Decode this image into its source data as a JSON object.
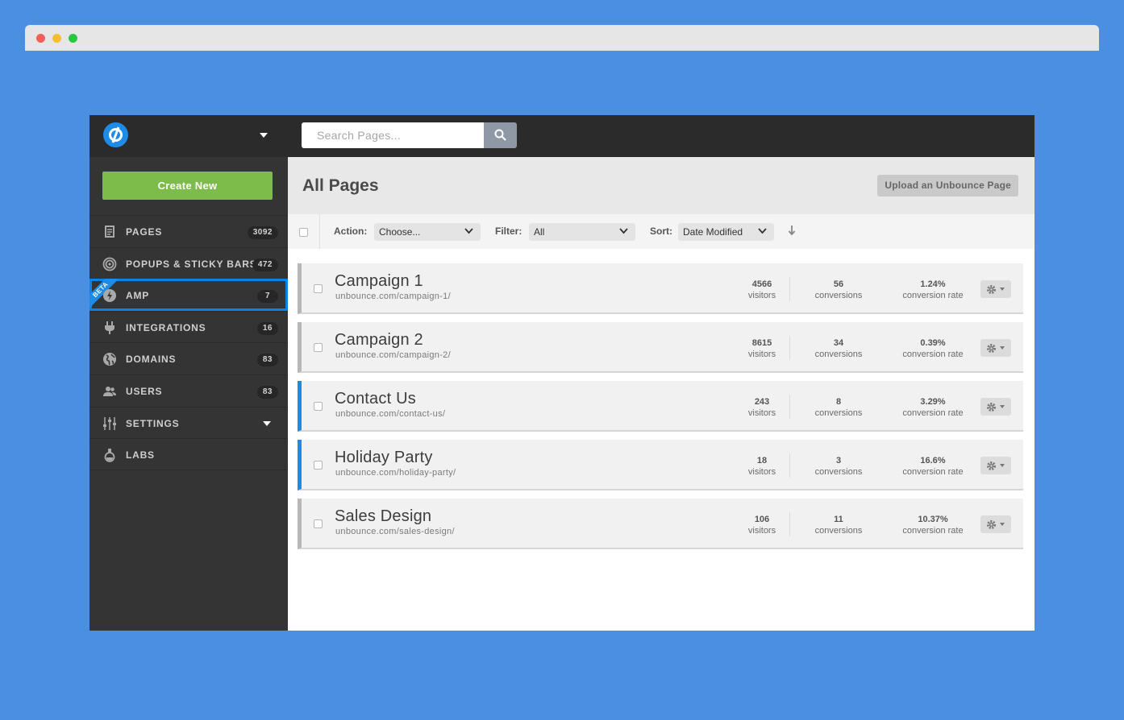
{
  "search": {
    "placeholder": "Search Pages..."
  },
  "sidebar": {
    "create_label": "Create New",
    "items": [
      {
        "label": "PAGES",
        "count": "3092",
        "icon": "pages-icon"
      },
      {
        "label": "POPUPS & STICKY BARS",
        "count": "472",
        "icon": "target-icon"
      },
      {
        "label": "AMP",
        "count": "7",
        "icon": "bolt-icon",
        "badge": "BETA"
      },
      {
        "label": "INTEGRATIONS",
        "count": "16",
        "icon": "plug-icon"
      },
      {
        "label": "DOMAINS",
        "count": "83",
        "icon": "globe-icon"
      },
      {
        "label": "USERS",
        "count": "83",
        "icon": "users-icon"
      },
      {
        "label": "SETTINGS",
        "count": "",
        "icon": "sliders-icon"
      },
      {
        "label": "LABS",
        "count": "",
        "icon": "flask-icon"
      }
    ]
  },
  "header": {
    "title": "All Pages",
    "upload_label": "Upload an Unbounce Page"
  },
  "toolbar": {
    "action_label": "Action:",
    "action_value": "Choose...",
    "filter_label": "Filter:",
    "filter_value": "All",
    "sort_label": "Sort:",
    "sort_value": "Date Modified"
  },
  "pages": [
    {
      "title": "Campaign 1",
      "url": "unbounce.com/campaign-1/",
      "visitors": "4566",
      "conversions": "56",
      "rate": "1.24%",
      "visitors_label": "visitors",
      "conversions_label": "conversions",
      "rate_label": "conversion rate",
      "accent": "#b7b7b7"
    },
    {
      "title": "Campaign 2",
      "url": "unbounce.com/campaign-2/",
      "visitors": "8615",
      "conversions": "34",
      "rate": "0.39%",
      "visitors_label": "visitors",
      "conversions_label": "conversions",
      "rate_label": "conversion rate",
      "accent": "#b7b7b7"
    },
    {
      "title": "Contact Us",
      "url": "unbounce.com/contact-us/",
      "visitors": "243",
      "conversions": "8",
      "rate": "3.29%",
      "visitors_label": "visitors",
      "conversions_label": "conversions",
      "rate_label": "conversion rate",
      "accent": "#1e8be6"
    },
    {
      "title": "Holiday Party",
      "url": "unbounce.com/holiday-party/",
      "visitors": "18",
      "conversions": "3",
      "rate": "16.6%",
      "visitors_label": "visitors",
      "conversions_label": "conversions",
      "rate_label": "conversion rate",
      "accent": "#1e8be6"
    },
    {
      "title": "Sales Design",
      "url": "unbounce.com/sales-design/",
      "visitors": "106",
      "conversions": "11",
      "rate": "10.37%",
      "visitors_label": "visitors",
      "conversions_label": "conversions",
      "rate_label": "conversion rate",
      "accent": "#b7b7b7"
    }
  ],
  "colors": {
    "brand": "#1e8be6",
    "create": "#7dbb4a",
    "background": "#4a8fe2"
  }
}
